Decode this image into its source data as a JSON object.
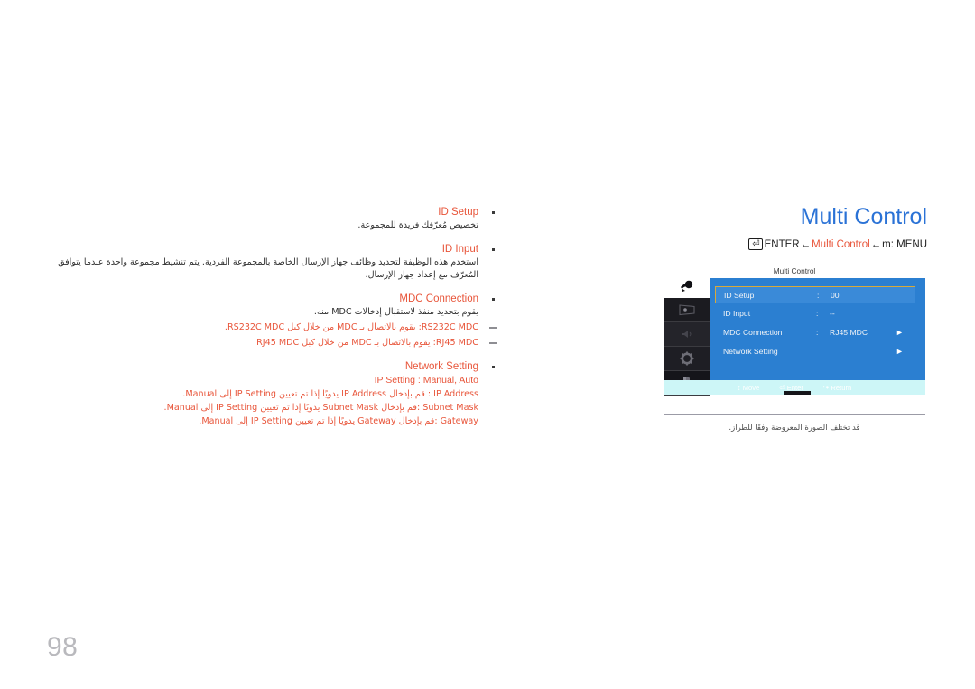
{
  "page": {
    "number": "98"
  },
  "doc": {
    "blocks": [
      {
        "heading": "ID Setup",
        "body": "تخصيص مُعرّفك فريدة للمجموعة."
      },
      {
        "heading": "ID Input",
        "body": "استخدم هذه الوظيفة لتحديد وظائف جهاز الإرسال الخاصة بالمجموعة الفردية. يتم تنشيط مجموعة واحدة عندما يتوافق المُعرّف مع إعداد جهاز الإرسال."
      },
      {
        "heading": "MDC Connection",
        "body": "يقوم بتحديد منفذ لاستقبال إدخالات MDC منه.",
        "subitems": [
          "RS232C MDC: يقوم بالاتصال بـ MDC من خلال كبل RS232C MDC.",
          "RJ45 MDC: يقوم بالاتصال بـ MDC من خلال كبل RJ45 MDC."
        ]
      },
      {
        "heading": "Network Setting",
        "lines_ltr": [
          "IP Setting : Manual, Auto"
        ],
        "lines_rtl": [
          "IP Address : قم بإدخال IP Address يدويًا إذا تم تعيين IP Setting إلى Manual.",
          "Subnet Mask :قم بإدخال Subnet Mask يدويًا إذا تم تعيين IP Setting إلى Manual.",
          "Gateway :قم بإدخال Gateway يدويًا إذا تم تعيين IP Setting إلى Manual."
        ]
      }
    ]
  },
  "illustration": {
    "title": "Multi Control",
    "nav": {
      "enter_label": "ENTER",
      "enter_icon": "enter-key-icon",
      "arrow": "←",
      "middle": "Multi Control",
      "menu_key": "m",
      "menu_label": ": MENU"
    },
    "osd": {
      "caption": "Multi Control",
      "icons": [
        "multi-control-icon",
        "picture-icon",
        "sound-icon",
        "system-gear-icon",
        "support-icon"
      ],
      "rows": [
        {
          "label": "ID Setup",
          "colon": ":",
          "value": "00",
          "arrow": "",
          "selected": true
        },
        {
          "label": "ID Input",
          "colon": ":",
          "value": "--",
          "arrow": "",
          "selected": false
        },
        {
          "label": "MDC Connection",
          "colon": ":",
          "value": "RJ45 MDC",
          "arrow": "►",
          "selected": false
        },
        {
          "label": "Network Setting",
          "colon": "",
          "value": "",
          "arrow": "►",
          "selected": false
        }
      ],
      "footer": [
        {
          "icon": "updown-arrow-icon",
          "label": "Move"
        },
        {
          "icon": "enter-icon",
          "label": "Enter"
        },
        {
          "icon": "return-icon",
          "label": "Return"
        }
      ]
    },
    "figure_caption": "قد تختلف الصورة المعروضة وفقًا للطراز."
  },
  "colors": {
    "title_blue": "#2a72d6",
    "accent_orange": "#e8553a",
    "osd_blue": "#2b7fd1",
    "osd_highlight_border": "#d8a93a",
    "osd_footer": "#cdf6f7"
  }
}
